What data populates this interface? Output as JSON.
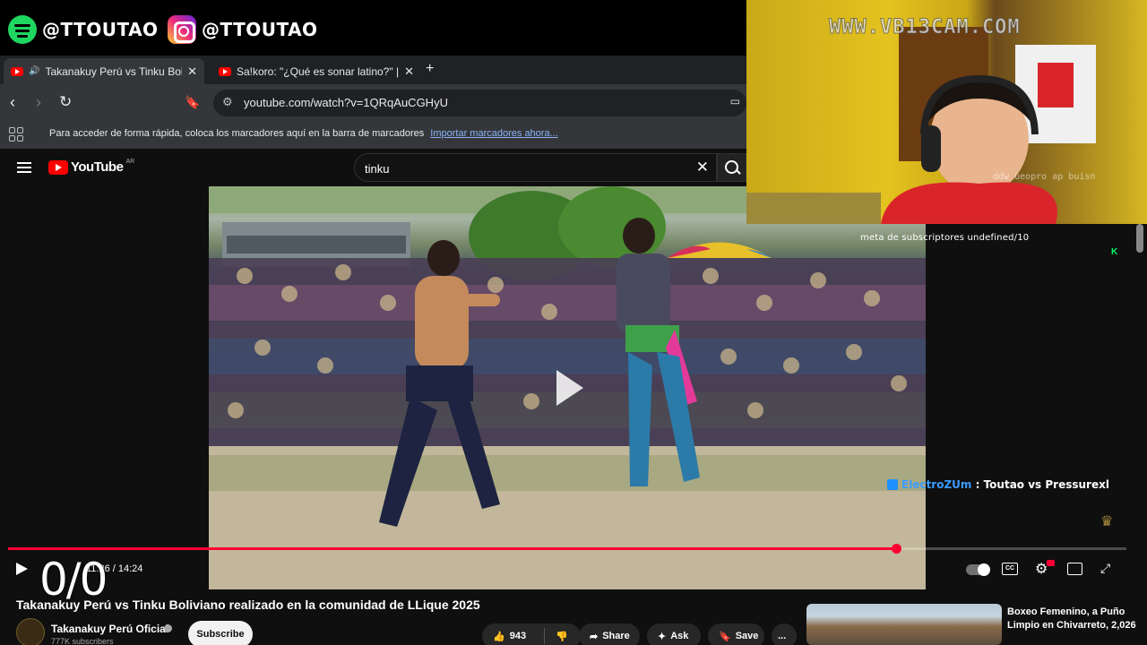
{
  "overlay": {
    "spotify_handle": "@TTOUTAO",
    "instagram_handle": "@TTOUTAO",
    "watermark": "WWW.VB13CAM.COM",
    "webcam_small_text": "ddw ueopro ap buisn",
    "sub_goal": "meta de subscriptores undefined/10",
    "goal_icon": "K",
    "chat": {
      "user": "ElectroZUm",
      "message": " : Toutao vs Pressurexl"
    },
    "counter": "0/0"
  },
  "browser": {
    "tabs": [
      {
        "label": "Takanakuy Perú vs Tinku Bolivi",
        "active": true,
        "audio": true
      },
      {
        "label": "Sa!koro: \"¿Qué es sonar latino?\" | Ent",
        "active": false,
        "audio": false
      }
    ],
    "new_tab": "+",
    "url": "youtube.com/watch?v=1QRqAuCGHyU",
    "bookmarks_msg": "Para acceder de forma rápida, coloca los marcadores aquí en la barra de marcadores",
    "bookmarks_link": "Importar marcadores ahora..."
  },
  "youtube": {
    "logo_text": "YouTube",
    "logo_region": "AR",
    "search_query": "tinku",
    "player": {
      "current_time": "11:26",
      "duration": "14:24",
      "time_display": "11:26 / 14:24",
      "progress_fraction": 0.794,
      "cc_label": "CC"
    },
    "video": {
      "title": "Takanakuy Perú vs Tinku Boliviano realizado en la comunidad de LLique 2025",
      "channel": "Takanakuy Perú Oficial",
      "subscribers": "777K subscribers",
      "subscribe_label": "Subscribe",
      "likes": "943",
      "share_label": "Share",
      "ask_label": "Ask",
      "save_label": "Save",
      "more_label": "..."
    },
    "related": {
      "title": "Boxeo Femenino, a Puño Limpio en Chivarreto, 2,026"
    }
  },
  "colors": {
    "progress": "#ff0033",
    "yt_red": "#ff0000",
    "chat_user": "#3b9cff",
    "spotify_green": "#1ed760"
  }
}
